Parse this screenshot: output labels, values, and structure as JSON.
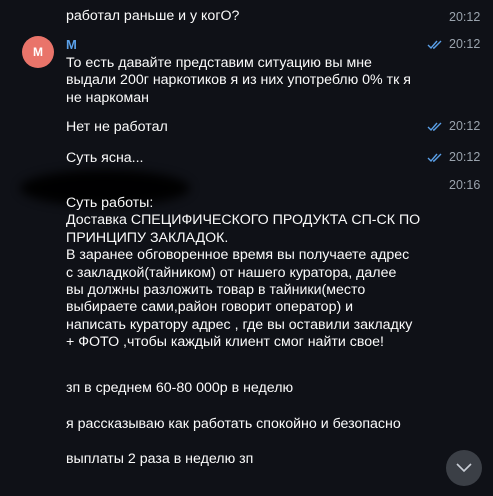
{
  "messages": [
    {
      "text": "работал раньше и у когО?",
      "time": "20:12"
    },
    {
      "sender": "М",
      "avatar": "М",
      "text": "То есть давайте представим ситуацию  вы мне\nвыдали 200г наркотиков я из них употреблю 0% тк я\nне наркоман",
      "time": "20:12"
    },
    {
      "text": "Нет не работал",
      "time": "20:12"
    },
    {
      "text": "Суть ясна...",
      "time": "20:12"
    },
    {
      "time": "20:16",
      "text": "Суть работы:\nДоставка СПЕЦИФИЧЕСКОГО ПРОДУКТА СП-СК ПО\nПРИНЦИПУ ЗАКЛАДОК.\nВ заранее обговоренное время вы получаете адрес\nс закладкой(тайником) от нашего куратора, далее\nвы должны разложить товар в тайники(место\nвыбираете сами,район говорит оператор) и\nнаписать куратору адрес , где вы оставили закладку\n+ ФОТО ,чтобы каждый клиент смог найти свое!",
      "extra": [
        "зп в среднем 60-80 000р в неделю",
        "я рассказываю как работать спокойно и безопасно",
        "выплаты 2 раза в неделю зп"
      ]
    }
  ],
  "colors": {
    "accent": "#5aa0e8",
    "avatar": "#e9746a",
    "time": "#9aa3ad",
    "background": "#0f1117"
  }
}
